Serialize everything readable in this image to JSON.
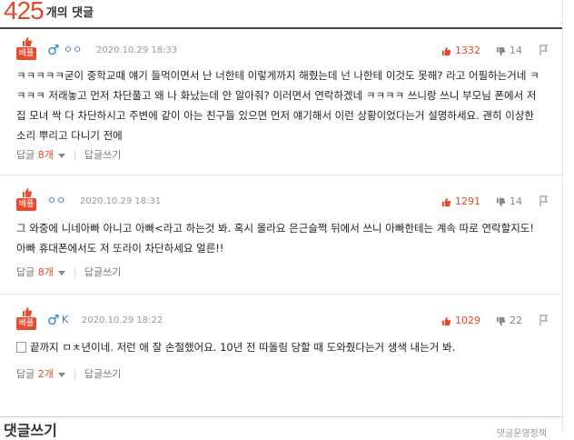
{
  "header": {
    "count": "425",
    "label": "개의 댓글"
  },
  "comments": [
    {
      "badge": "베플",
      "gender_symbol": "♂",
      "nickname": "ㅇㅇ",
      "date": "2020.10.29 18:33",
      "likes": "1332",
      "dislikes": "14",
      "body": "ㅋㅋㅋㅋㅋ굳이 중학교때 얘기 들먹이면서 난 너한테 이렇게까지 해줬는데 넌 나한테 이것도 못해? 라고 어필하는거네 ㅋㅋㅋㅋ 저래놓고 먼저 차단풀고 왜 나 화났는데 안 알아줘? 이러면서 연락하겠네 ㅋㅋㅋㅋ 쓰니랑 쓰니 부모님 폰에서 저 집 모녀 싹 다 차단하시고 주변에 같이 아는 친구들 있으면 먼저 얘기해서 이런 상황이었다는거 설명하세요. 괜히 이상한 소리 뿌리고 다니기 전에",
      "reply_label": "답글",
      "reply_count": "8개",
      "write_reply": "답글쓰기"
    },
    {
      "badge": "베플",
      "gender_symbol": "",
      "nickname": "ㅇㅇ",
      "date": "2020.10.29 18:31",
      "likes": "1291",
      "dislikes": "14",
      "body": "그 와중에 니네아빠 아니고 아빠<라고 하는것 봐. 혹시 몰라요 은근슬쩍 뒤에서 쓰니 아빠한테는 계속 따로 연락할지도! 아빠 휴대폰에서도 저 또라이 차단하세요 얼른!!",
      "reply_label": "답글",
      "reply_count": "8개",
      "write_reply": "답글쓰기"
    },
    {
      "badge": "베플",
      "gender_symbol": "♂",
      "nickname": "K",
      "date": "2020.10.29 18:22",
      "likes": "1029",
      "dislikes": "22",
      "body": "끝까지 ㅁㅊ년이네. 저런 애 잘 손절했어요. 10년 전 따돌림 당할 때 도와줬다는거 생색 내는거 봐.",
      "reply_label": "답글",
      "reply_count": "2개",
      "write_reply": "답글쓰기"
    }
  ],
  "footer": {
    "title": "댓글쓰기",
    "note": "댓글운영정책"
  },
  "colors": {
    "accent": "#e8462b",
    "nick": "#3d7ac4",
    "badge": "#e94b2f"
  }
}
